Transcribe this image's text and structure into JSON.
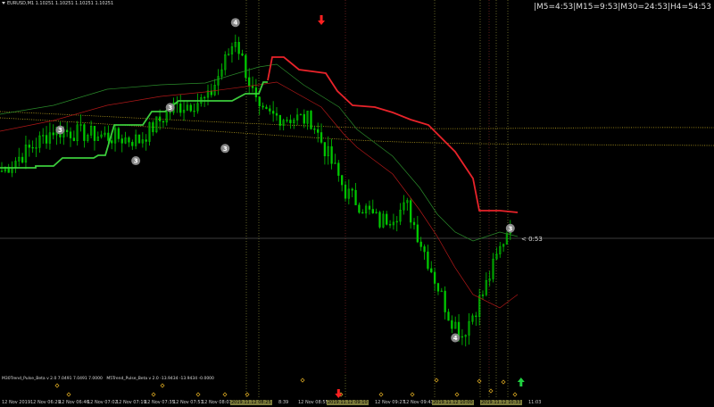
{
  "header": {
    "symbol_line": "EURUSD,M1  1.10251 1.10251 1.10251 1.10251",
    "timer_text": "|M5=4:53|M15=9:53|M30=24:53|H4=54:53"
  },
  "price_label": "< 0:53",
  "markers": {
    "circles": [
      {
        "label": "4",
        "price": 1.10345,
        "bar": 68
      },
      {
        "label": "3",
        "price": 1.1024,
        "bar": 17
      },
      {
        "label": "3",
        "price": 1.10262,
        "bar": 49
      },
      {
        "label": "3",
        "price": 1.10222,
        "bar": 65
      },
      {
        "label": "3",
        "price": 1.1021,
        "bar": 39
      },
      {
        "label": "3",
        "price": 1.10144,
        "bar": 148
      },
      {
        "label": "4",
        "price": 1.10037,
        "bar": 132
      }
    ],
    "down_arrow_top": {
      "bar": 93
    },
    "down_arrow_bottom": {
      "bar": 98
    },
    "up_arrow_bottom": {
      "bar": 148
    }
  },
  "indicator": {
    "legend_1": "M30Trend_Pulse_Beta v 2.0 7.0491 7.0491 7.0000",
    "legend_2": "M5Trend_Pulse_Beta v 2.0 -13.9434 -13.9434 -0.0000"
  },
  "time_axis": {
    "ticks": [
      {
        "label": "12 Nov 2019",
        "hl": false
      },
      {
        "label": "12 Nov 06:29",
        "hl": false
      },
      {
        "label": "12 Nov 06:46",
        "hl": false
      },
      {
        "label": "12 Nov 07:02",
        "hl": false
      },
      {
        "label": "12 Nov 07:19",
        "hl": false
      },
      {
        "label": "12 Nov 07:35",
        "hl": false
      },
      {
        "label": "12 Nov 07:51",
        "hl": false
      },
      {
        "label": "12 Nov 08:07",
        "hl": false
      },
      {
        "label": "2019.11.12 08:25",
        "hl": true
      },
      {
        "label": "8:39",
        "hl": false
      },
      {
        "label": "12 Nov 08:55",
        "hl": false
      },
      {
        "label": "2019.11.12 09:10",
        "hl": true
      },
      {
        "label": "12 Nov 09:27",
        "hl": false
      },
      {
        "label": "12 Nov 09:43",
        "hl": false
      },
      {
        "label": "2019.11.12 10:00",
        "hl": true
      },
      {
        "label": "2019.11.12 10:33",
        "hl": true
      },
      {
        "label": "11:03",
        "hl": false
      }
    ]
  },
  "colors": {
    "bull": "#00c800",
    "price_line": "#00c800",
    "trend_green": "#3ccc3c",
    "trend_red": "#e8232a",
    "thin_red": "#b01818",
    "thin_green": "#2a8a2a",
    "dotted_yellow": "#b8a020",
    "vline": "#a0a040",
    "marker_fill": "#888888",
    "arrow_red": "#ff2020",
    "arrow_green": "#20d040"
  }
}
